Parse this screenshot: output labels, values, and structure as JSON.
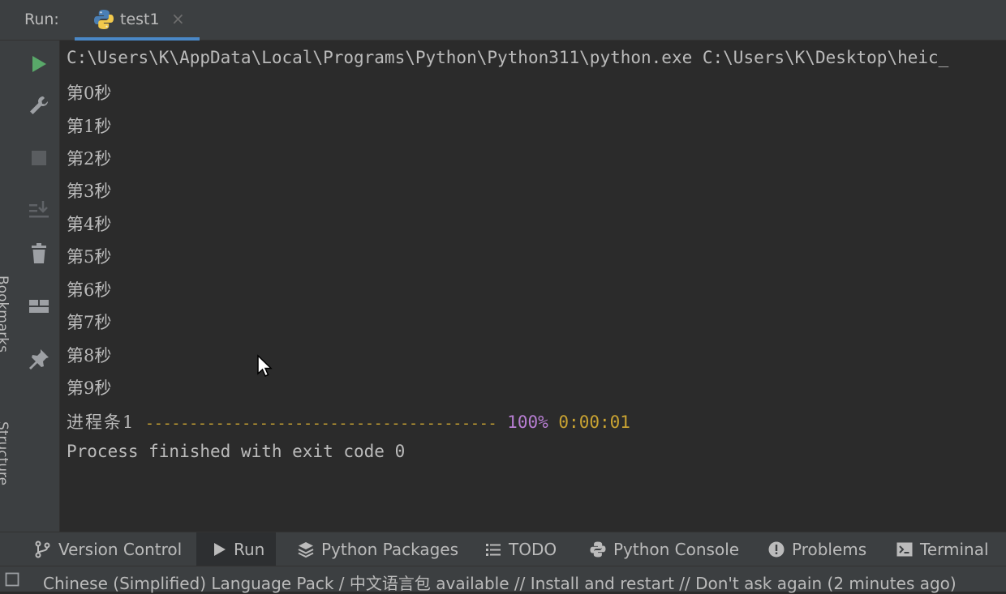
{
  "run_panel": {
    "label": "Run:",
    "tab": {
      "title": "test1",
      "icon": "python-icon"
    }
  },
  "side_labels": {
    "bookmarks": "Bookmarks",
    "structure": "Structure"
  },
  "toolbar": {
    "icons": [
      "rerun-icon",
      "wrench-icon",
      "stop-icon",
      "scroll-to-end-icon",
      "trash-icon",
      "layout-icon",
      "pin-icon"
    ]
  },
  "console": {
    "command": "C:\\Users\\K\\AppData\\Local\\Programs\\Python\\Python311\\python.exe C:\\Users\\K\\Desktop\\heic_",
    "lines": [
      "第0秒",
      "第1秒",
      "第2秒",
      "第3秒",
      "第4秒",
      "第5秒",
      "第6秒",
      "第7秒",
      "第8秒",
      "第9秒"
    ],
    "progress": {
      "label": "进程条1",
      "bar": "----------------------------------------",
      "percent": "100%",
      "elapsed": "0:00:01",
      "value": 1.0
    },
    "exit_message": "Process finished with exit code 0"
  },
  "bottom_tabs": [
    {
      "label": "Version Control",
      "icon": "branch-icon"
    },
    {
      "label": "Run",
      "icon": "play-icon",
      "active": true
    },
    {
      "label": "Python Packages",
      "icon": "layers-icon"
    },
    {
      "label": "TODO",
      "icon": "list-icon"
    },
    {
      "label": "Python Console",
      "icon": "python-console-icon"
    },
    {
      "label": "Problems",
      "icon": "alert-icon"
    },
    {
      "label": "Terminal",
      "icon": "terminal-icon"
    }
  ],
  "status": {
    "text": "Chinese (Simplified) Language Pack / 中文语言包 available // Install and restart // Don't ask again (2 minutes ago)"
  },
  "colors": {
    "accent": "#4a88c7",
    "run_green": "#59a869",
    "progress_yellow": "#c9a332",
    "percent_purple": "#b77ed2"
  }
}
